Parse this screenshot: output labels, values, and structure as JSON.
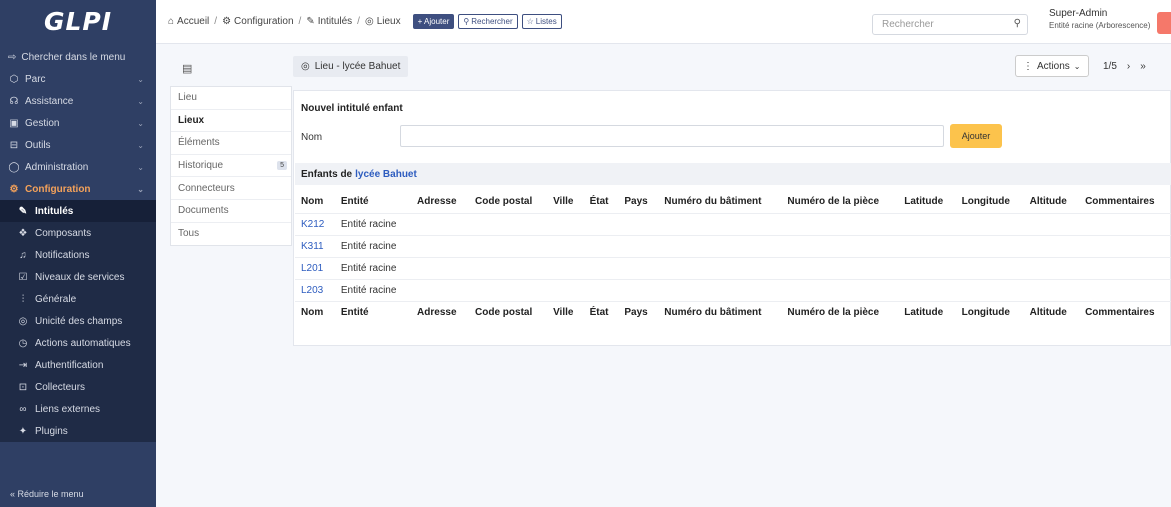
{
  "logo": "GLPI",
  "sidebar": {
    "search": "Chercher dans le menu",
    "items": [
      {
        "label": "Parc",
        "icon": "cube-icon"
      },
      {
        "label": "Assistance",
        "icon": "headset-icon"
      },
      {
        "label": "Gestion",
        "icon": "wallet-icon"
      },
      {
        "label": "Outils",
        "icon": "briefcase-icon"
      },
      {
        "label": "Administration",
        "icon": "shield-icon"
      },
      {
        "label": "Configuration",
        "icon": "gear-icon"
      }
    ],
    "subitems": [
      {
        "label": "Intitulés",
        "icon": "edit-icon"
      },
      {
        "label": "Composants",
        "icon": "components-icon"
      },
      {
        "label": "Notifications",
        "icon": "bell-icon"
      },
      {
        "label": "Niveaux de services",
        "icon": "checklist-icon"
      },
      {
        "label": "Générale",
        "icon": "sliders-icon"
      },
      {
        "label": "Unicité des champs",
        "icon": "fingerprint-icon"
      },
      {
        "label": "Actions automatiques",
        "icon": "clock-icon"
      },
      {
        "label": "Authentification",
        "icon": "login-icon"
      },
      {
        "label": "Collecteurs",
        "icon": "inbox-icon"
      },
      {
        "label": "Liens externes",
        "icon": "link-icon"
      },
      {
        "label": "Plugins",
        "icon": "puzzle-icon"
      }
    ],
    "collapse": "Réduire le menu"
  },
  "topbar": {
    "breadcrumbs": [
      "Accueil",
      "Configuration",
      "Intitulés",
      "Lieux"
    ],
    "add_label": "+ Ajouter",
    "search_label": "Rechercher",
    "lists_label": "Listes",
    "search_placeholder": "Rechercher",
    "user_name": "Super-Admin",
    "user_entity": "Entité racine (Arborescence)"
  },
  "header": {
    "item_title": "Lieu - lycée Bahuet",
    "actions_label": "Actions",
    "pager": "1/5"
  },
  "tabs": [
    {
      "label": "Lieu"
    },
    {
      "label": "Lieux"
    },
    {
      "label": "Éléments"
    },
    {
      "label": "Historique",
      "count": "5"
    },
    {
      "label": "Connecteurs"
    },
    {
      "label": "Documents"
    },
    {
      "label": "Tous"
    }
  ],
  "form": {
    "title": "Nouvel intitulé enfant",
    "name_label": "Nom",
    "submit": "Ajouter"
  },
  "children": {
    "title_prefix": "Enfants de",
    "parent_name": "lycée Bahuet",
    "columns": [
      "Nom",
      "Entité",
      "Adresse",
      "Code postal",
      "Ville",
      "État",
      "Pays",
      "Numéro du bâtiment",
      "Numéro de la pièce",
      "Latitude",
      "Longitude",
      "Altitude",
      "Commentaires"
    ],
    "rows": [
      [
        "K212",
        "Entité racine"
      ],
      [
        "K311",
        "Entité racine"
      ],
      [
        "L201",
        "Entité racine"
      ],
      [
        "L203",
        "Entité racine"
      ]
    ]
  }
}
